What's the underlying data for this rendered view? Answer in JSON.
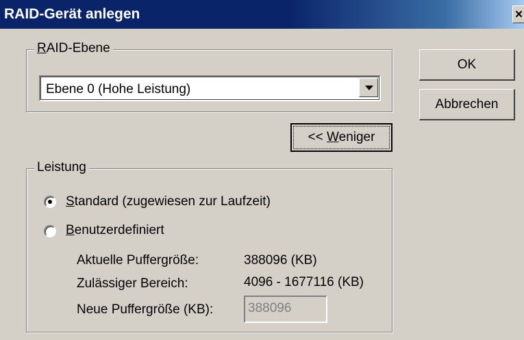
{
  "window": {
    "title": "RAID-Gerät anlegen",
    "close_symbol": "×"
  },
  "raid_level": {
    "group_label_accel": "R",
    "group_label_rest": "AID-Ebene",
    "selected": "Ebene 0 (Hohe Leistung)"
  },
  "buttons": {
    "ok": "OK",
    "cancel": "Abbrechen",
    "less_prefix": "<< ",
    "less_accel": "W",
    "less_rest": "eniger"
  },
  "performance": {
    "group_label": "Leistung",
    "standard_accel": "S",
    "standard_rest": "tandard (zugewiesen zur Laufzeit)",
    "standard_checked": true,
    "custom_accel": "B",
    "custom_rest": "enutzerdefiniert",
    "custom_checked": false,
    "current_buffer_label": "Aktuelle Puffergröße:",
    "current_buffer_value": "388096 (KB)",
    "allowed_range_label": "Zulässiger Bereich:",
    "allowed_range_value": "4096 - 1677116 (KB)",
    "new_buffer_label": "Neue Puffergröße (KB):",
    "new_buffer_value": "388096"
  }
}
